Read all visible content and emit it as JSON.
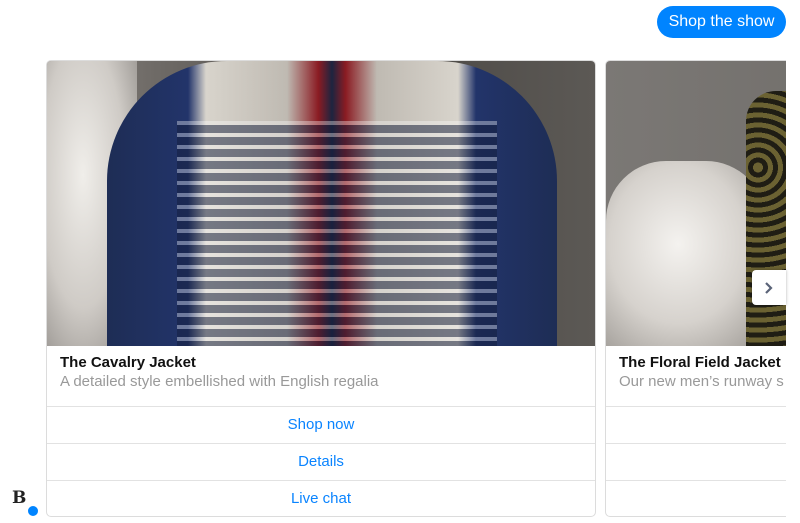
{
  "quick_reply": {
    "label": "Shop the show"
  },
  "carousel": {
    "cards": [
      {
        "title": "The Cavalry Jacket",
        "subtitle": "A detailed style embellished with English regalia",
        "buttons": [
          "Shop now",
          "Details",
          "Live chat"
        ]
      },
      {
        "title": "The Floral Field Jacket",
        "subtitle": "Our new men’s runway s"
      }
    ],
    "next_icon": "chevron-right-icon"
  },
  "sender": {
    "logo_letter": "B",
    "badge_icon": "messenger-icon"
  },
  "colors": {
    "accent": "#0084ff",
    "button_text": "#0a84ff"
  }
}
